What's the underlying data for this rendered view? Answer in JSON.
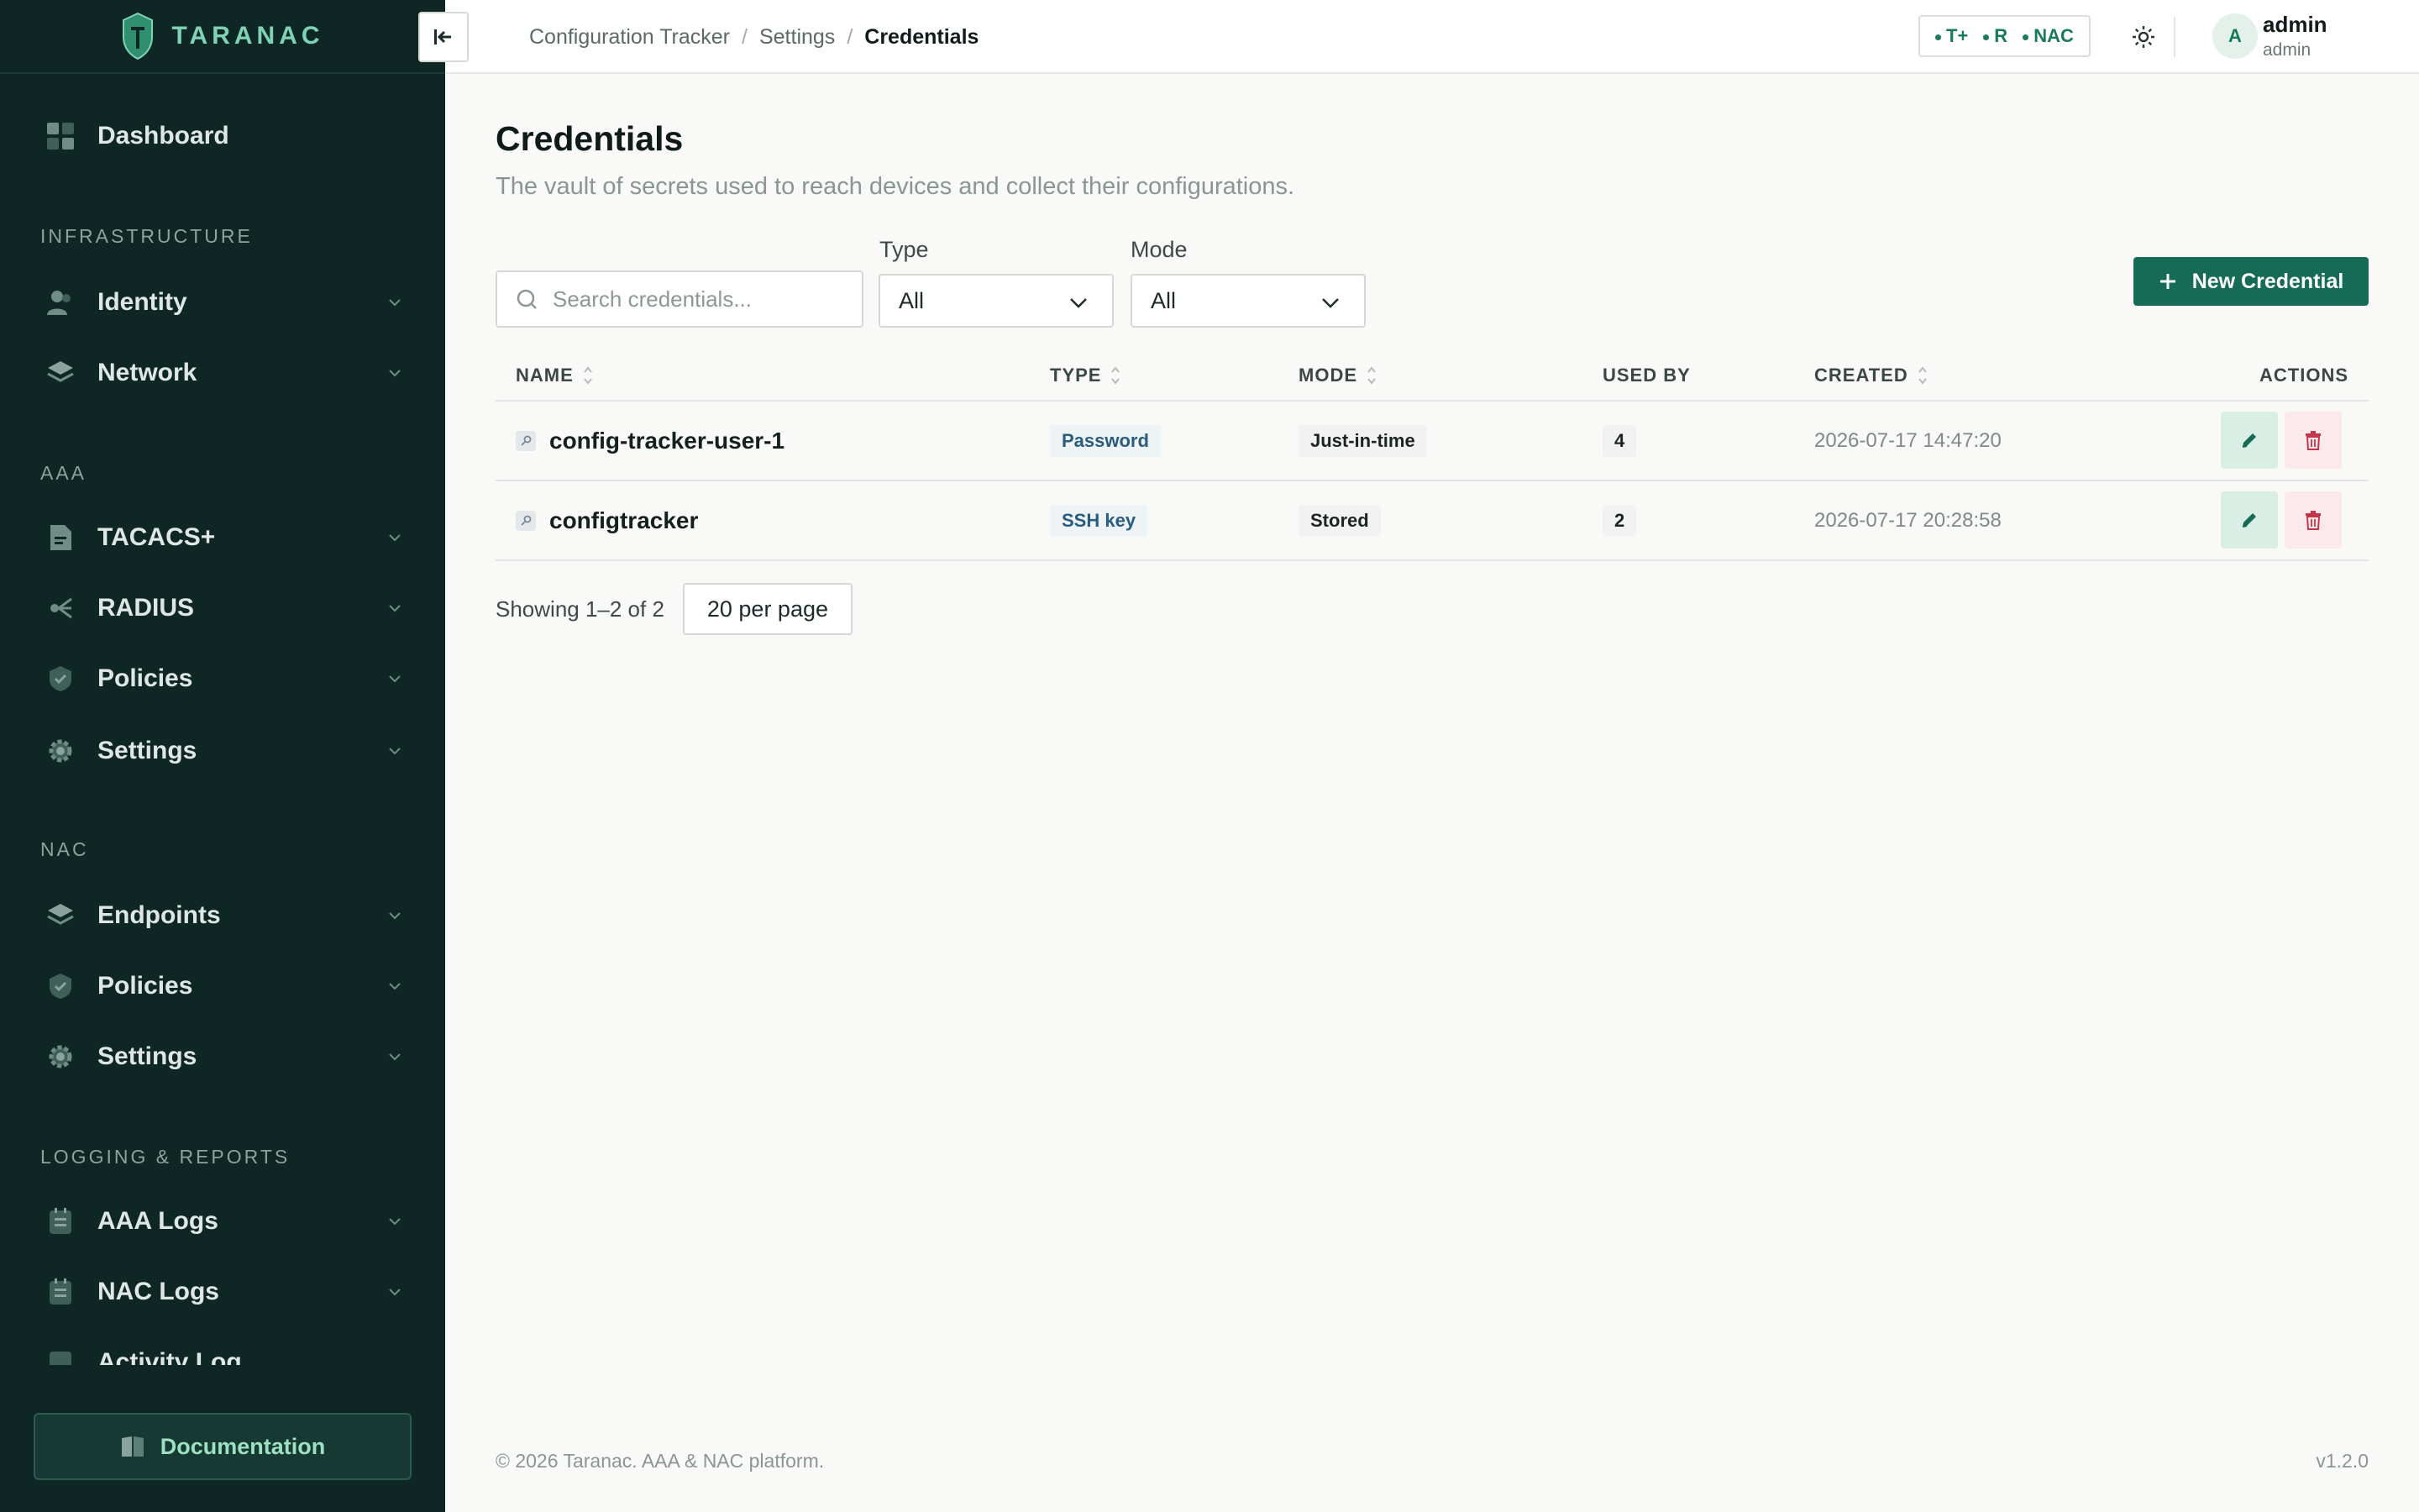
{
  "brand": {
    "name": "TARANAC"
  },
  "sidebar": {
    "dashboard": "Dashboard",
    "sections": {
      "infrastructure": "INFRASTRUCTURE",
      "aaa": "AAA",
      "nac": "NAC",
      "logging": "LOGGING & REPORTS"
    },
    "items": {
      "identity": "Identity",
      "network": "Network",
      "tacacs": "TACACS+",
      "radius": "RADIUS",
      "aaa_policies": "Policies",
      "aaa_settings": "Settings",
      "endpoints": "Endpoints",
      "nac_policies": "Policies",
      "nac_settings": "Settings",
      "aaa_logs": "AAA Logs",
      "nac_logs": "NAC Logs",
      "activity_log": "Activity Log"
    },
    "documentation": "Documentation"
  },
  "topbar": {
    "breadcrumb": [
      "Configuration Tracker",
      "Settings",
      "Credentials"
    ],
    "separator": "/",
    "protocols": [
      "T+",
      "R",
      "NAC"
    ],
    "user": {
      "initial": "A",
      "name": "admin",
      "role": "admin"
    }
  },
  "page": {
    "title": "Credentials",
    "subtitle": "The vault of secrets used to reach devices and collect their configurations."
  },
  "filters": {
    "search_placeholder": "Search credentials...",
    "type_label": "Type",
    "type_value": "All",
    "mode_label": "Mode",
    "mode_value": "All",
    "new_button": "New Credential"
  },
  "table": {
    "columns": {
      "name": "NAME",
      "type": "TYPE",
      "mode": "MODE",
      "used_by": "USED BY",
      "created": "CREATED",
      "actions": "ACTIONS"
    },
    "rows": [
      {
        "name": "config-tracker-user-1",
        "type": "Password",
        "mode": "Just-in-time",
        "used_by": "4",
        "created": "2026-07-17 14:47:20"
      },
      {
        "name": "configtracker",
        "type": "SSH key",
        "mode": "Stored",
        "used_by": "2",
        "created": "2026-07-17 20:28:58"
      }
    ]
  },
  "pagination": {
    "info": "Showing 1–2 of 2",
    "per_page": "20 per page"
  },
  "footer": {
    "copyright": "© 2026 Taranac. AAA & NAC platform.",
    "version": "v1.2.0"
  },
  "colors": {
    "sidebar_bg": "#0f2724",
    "accent": "#156b55",
    "brand_text": "#7fd3b4",
    "danger": "#c7354a"
  }
}
